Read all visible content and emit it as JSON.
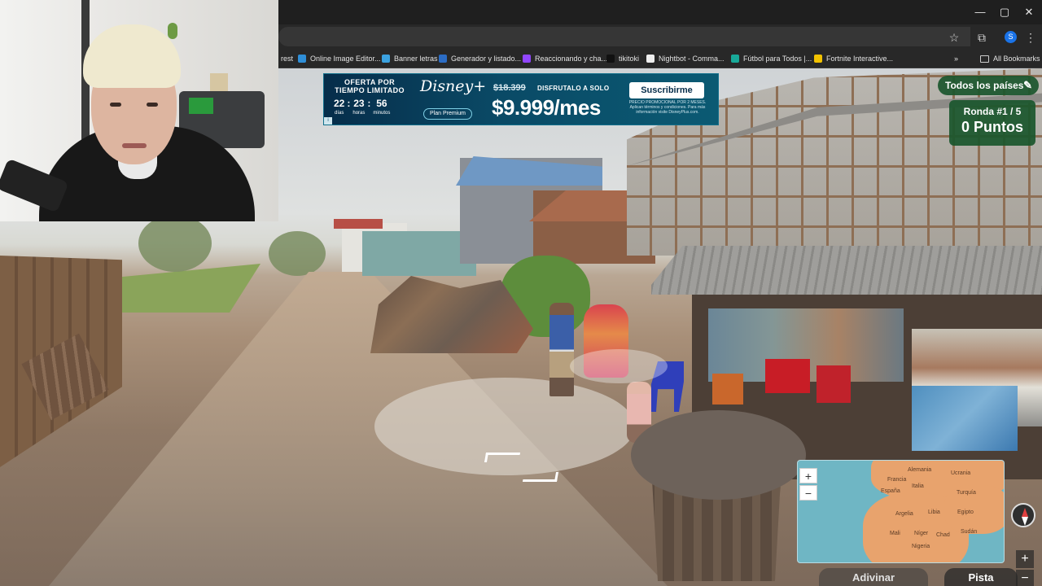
{
  "window_controls": {
    "minimize": "—",
    "maximize": "▢",
    "close": "✕"
  },
  "toolbar": {
    "star_icon": "☆",
    "extensions_icon": "⧉",
    "profile_letter": "S",
    "menu_icon": "⋮"
  },
  "bookmarks": {
    "items": [
      {
        "label": "rest",
        "color": "#e60023"
      },
      {
        "label": "Online Image Editor...",
        "color": "#2f8fd8"
      },
      {
        "label": "Banner letras",
        "color": "#3ba2e0"
      },
      {
        "label": "Generador y listado...",
        "color": "#2b6cc4"
      },
      {
        "label": "Reaccionando y cha...",
        "color": "#9146ff"
      },
      {
        "label": "tikitoki",
        "color": "#111111"
      },
      {
        "label": "Nightbot - Comma...",
        "color": "#eeeeee"
      },
      {
        "label": "Fútbol para Todos |...",
        "color": "#18a999"
      },
      {
        "label": "Fortnite Interactive...",
        "color": "#f2c200"
      }
    ],
    "overflow": "»",
    "all_bookmarks": "All Bookmarks"
  },
  "ad": {
    "offer_line1": "OFERTA POR",
    "offer_line2": "TIEMPO LIMITADO",
    "countdown": [
      {
        "value": "22",
        "unit": "días"
      },
      {
        "value": "23",
        "unit": "horas"
      },
      {
        "value": "56",
        "unit": "minutos"
      }
    ],
    "logo": "Disney+",
    "plan": "Plan Premium",
    "old_price": "$18.399",
    "tagline": "DISFRUTALO A SOLO",
    "price": "$9.999/mes",
    "cta": "Suscribirme",
    "fine_print": "PRECIO PROMOCIONAL POR 2 MESES. Aplican términos y condiciones. Para más información visite DisneyPlus.com."
  },
  "hud": {
    "country_filter": "Todos los países",
    "round": "Ronda #1 / 5",
    "points": "0 Puntos"
  },
  "minimap": {
    "labels": [
      "Alemania",
      "Francia",
      "Ucrania",
      "España",
      "Italia",
      "Turquía",
      "Argelia",
      "Libia",
      "Egipto",
      "Mali",
      "Níger",
      "Chad",
      "Sudán",
      "Nigeria"
    ]
  },
  "controls": {
    "zoom_in": "+",
    "zoom_out": "−",
    "guess": "Adivinar",
    "hint": "Pista",
    "side_plus": "+",
    "side_minus": "−"
  }
}
